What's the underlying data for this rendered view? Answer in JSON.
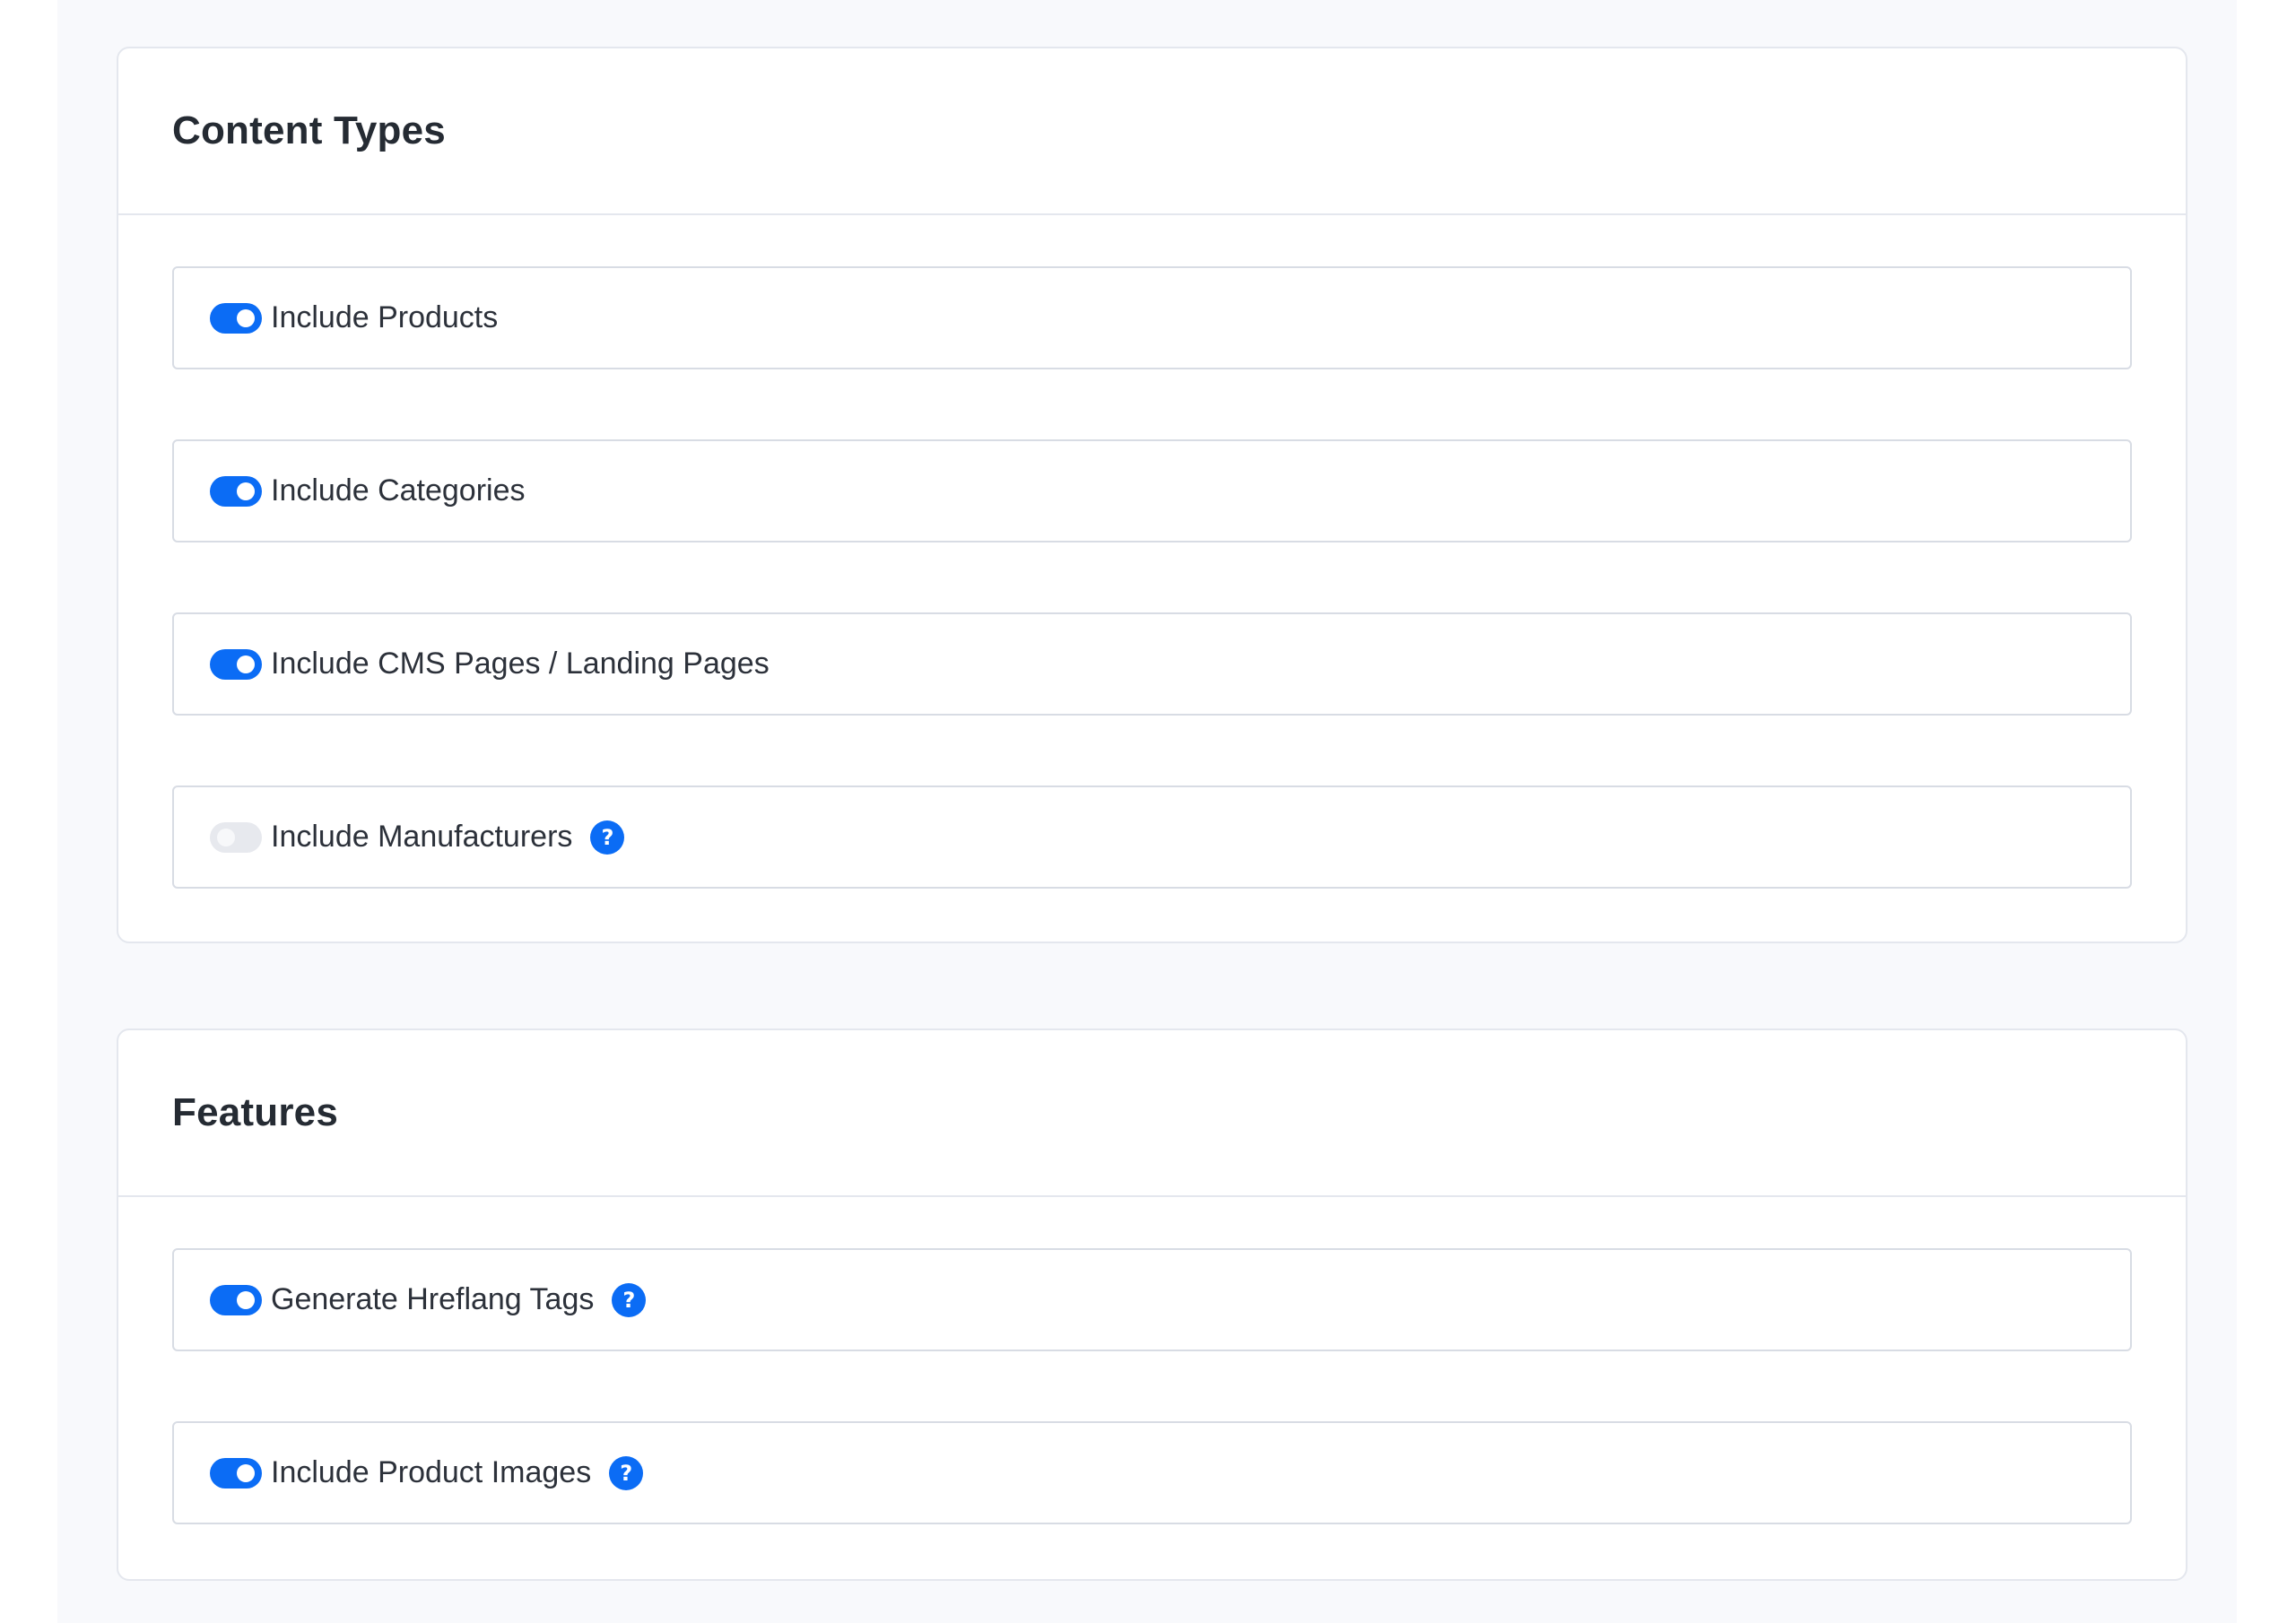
{
  "sections": [
    {
      "title": "Content Types",
      "options": [
        {
          "label": "Include Products",
          "enabled": true,
          "help": false
        },
        {
          "label": "Include Categories",
          "enabled": true,
          "help": false
        },
        {
          "label": "Include CMS Pages / Landing Pages",
          "enabled": true,
          "help": false
        },
        {
          "label": "Include Manufacturers",
          "enabled": false,
          "help": true
        }
      ]
    },
    {
      "title": "Features",
      "options": [
        {
          "label": "Generate Hreflang Tags",
          "enabled": true,
          "help": true
        },
        {
          "label": "Include Product Images",
          "enabled": true,
          "help": true
        }
      ]
    }
  ],
  "icons": {
    "help_glyph": "?",
    "toggle": "toggle-switch-icon",
    "help": "question-circle-icon"
  },
  "colors": {
    "accent": "#0b6cf5",
    "toggle_off": "#e7e9ee",
    "border": "#d8dce4",
    "page_bg": "#f8f9fc"
  }
}
